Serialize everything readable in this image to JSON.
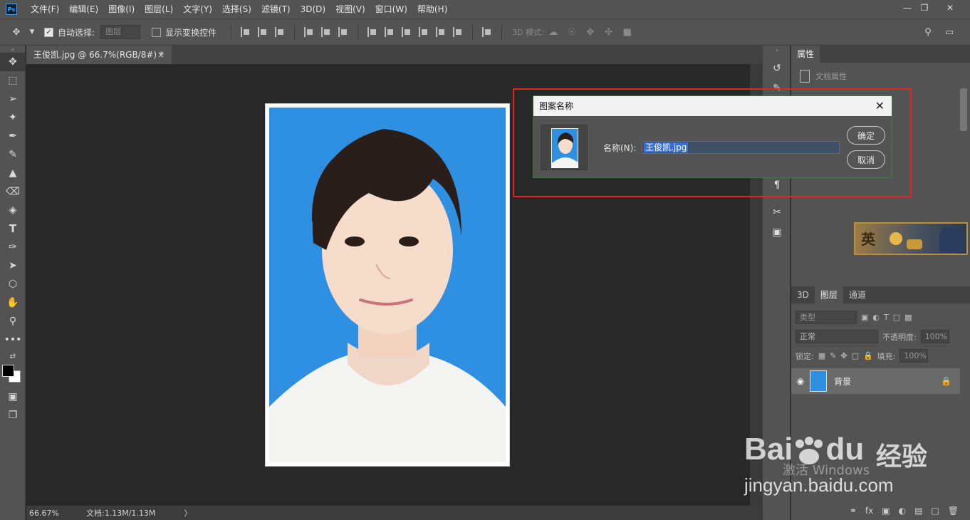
{
  "app": {
    "logo": "Ps"
  },
  "menu": [
    "文件(F)",
    "编辑(E)",
    "图像(I)",
    "图层(L)",
    "文字(Y)",
    "选择(S)",
    "滤镜(T)",
    "3D(D)",
    "视图(V)",
    "窗口(W)",
    "帮助(H)"
  ],
  "options": {
    "auto_select_label": "自动选择:",
    "auto_select_target": "图层",
    "show_transform_label": "显示变换控件",
    "mode_3d_label": "3D 模式:"
  },
  "document": {
    "tab_title": "王俊凯.jpg @ 66.7%(RGB/8#) *",
    "close": "×"
  },
  "status": {
    "zoom": "66.67%",
    "doc_size": "文档:1.13M/1.13M",
    "arrow": "〉"
  },
  "properties_panel": {
    "tab": "属性",
    "doc_props": "文档属性"
  },
  "layers_panel": {
    "tabs": [
      "3D",
      "图层",
      "通道"
    ],
    "filter_kind": "类型",
    "blend_mode": "正常",
    "opacity_label": "不透明度:",
    "opacity_value": "100%",
    "lock_label": "锁定:",
    "fill_label": "填充:",
    "fill_value": "100%",
    "layer_name": "背景"
  },
  "dialog": {
    "title": "图案名称",
    "name_label": "名称(N):",
    "name_value": "王俊凯.jpg",
    "ok": "确定",
    "cancel": "取消"
  },
  "banner": {
    "text": "英"
  },
  "watermark": {
    "brand": "Bai",
    "brand2": "du",
    "brand_cn": "经验",
    "url": "jingyan.baidu.com",
    "activate": "激活 Windows"
  },
  "colors": {
    "accent_highlight": "#e8231d",
    "photo_bg": "#2f8fe0",
    "ui_panel": "#535353"
  }
}
